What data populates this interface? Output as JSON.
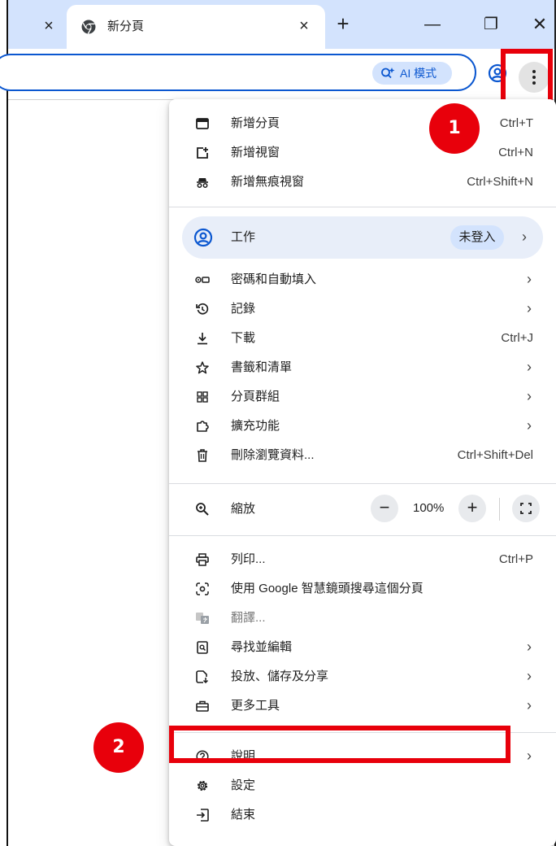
{
  "tabs": {
    "active_title": "新分頁",
    "close_glyph": "×",
    "new_tab_glyph": "+"
  },
  "window_controls": {
    "minimize": "—",
    "restore": "❐",
    "close": "✕"
  },
  "toolbar": {
    "ai_mode_label": "AI 模式"
  },
  "menu": {
    "group1": [
      {
        "label": "新增分頁",
        "shortcut": "Ctrl+T",
        "icon": "new-tab-icon"
      },
      {
        "label": "新增視窗",
        "shortcut": "Ctrl+N",
        "icon": "new-window-icon"
      },
      {
        "label": "新增無痕視窗",
        "shortcut": "Ctrl+Shift+N",
        "icon": "incognito-icon"
      }
    ],
    "profile": {
      "label": "工作",
      "badge": "未登入",
      "arrow": "›"
    },
    "group2": [
      {
        "label": "密碼和自動填入",
        "arrow": "›",
        "icon": "key-icon"
      },
      {
        "label": "記錄",
        "arrow": "›",
        "icon": "history-icon"
      },
      {
        "label": "下載",
        "shortcut": "Ctrl+J",
        "icon": "download-icon"
      },
      {
        "label": "書籤和清單",
        "arrow": "›",
        "icon": "star-icon"
      },
      {
        "label": "分頁群組",
        "arrow": "›",
        "icon": "tab-groups-icon"
      },
      {
        "label": "擴充功能",
        "arrow": "›",
        "icon": "extension-icon"
      },
      {
        "label": "刪除瀏覽資料...",
        "shortcut": "Ctrl+Shift+Del",
        "icon": "trash-icon"
      }
    ],
    "zoom": {
      "label": "縮放",
      "value": "100%",
      "minus": "−",
      "plus": "+"
    },
    "group3": [
      {
        "label": "列印...",
        "shortcut": "Ctrl+P",
        "icon": "print-icon"
      },
      {
        "label": "使用 Google 智慧鏡頭搜尋這個分頁",
        "icon": "lens-icon"
      },
      {
        "label": "翻譯...",
        "icon": "translate-icon"
      },
      {
        "label": "尋找並編輯",
        "arrow": "›",
        "icon": "find-icon"
      },
      {
        "label": "投放、儲存及分享",
        "arrow": "›",
        "icon": "cast-save-share-icon"
      },
      {
        "label": "更多工具",
        "arrow": "›",
        "icon": "toolbox-icon"
      }
    ],
    "group4": [
      {
        "label": "說明",
        "arrow": "›",
        "icon": "help-icon"
      },
      {
        "label": "設定",
        "icon": "settings-gear-icon"
      },
      {
        "label": "結束",
        "icon": "exit-icon"
      }
    ]
  },
  "annotations": {
    "badge1": "1",
    "badge2": "2",
    "highlight_color": "#e8000b"
  },
  "colors": {
    "tabstrip": "#d3e3fd",
    "accent": "#0b57d0",
    "profile_row": "#e8eef9"
  }
}
